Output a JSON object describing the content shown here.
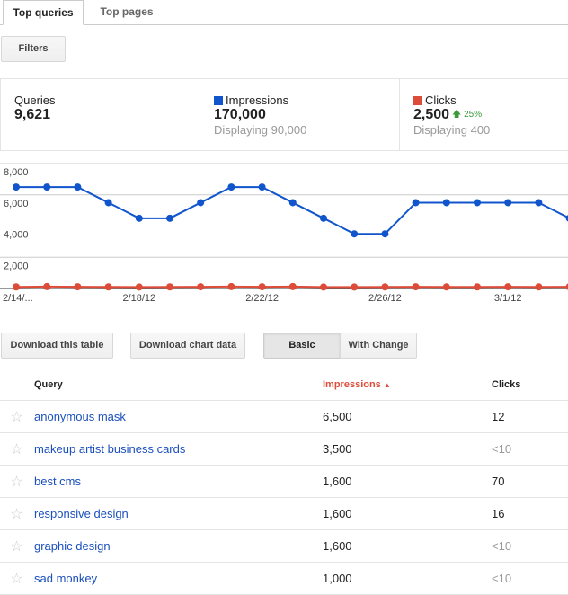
{
  "tabs": [
    {
      "label": "Top queries",
      "active": true
    },
    {
      "label": "Top pages",
      "active": false
    }
  ],
  "filters_label": "Filters",
  "summary": {
    "queries": {
      "label": "Queries",
      "value": "9,621"
    },
    "impressions": {
      "label": "Impressions",
      "value": "170,000",
      "sub": "Displaying 90,000",
      "color": "#1155cc"
    },
    "clicks": {
      "label": "Clicks",
      "value": "2,500",
      "change": "25%",
      "change_icon": "arrow-up-icon",
      "sub": "Displaying 400",
      "color": "#dd4b39"
    }
  },
  "chart_data": {
    "type": "line",
    "title": "",
    "xlabel": "",
    "ylabel": "",
    "ylim": [
      0,
      8000
    ],
    "yticks": [
      "2,000",
      "4,000",
      "6,000",
      "8,000"
    ],
    "ytick_values": [
      2000,
      4000,
      6000,
      8000
    ],
    "x": [
      "2/14/12",
      "2/15/12",
      "2/16/12",
      "2/17/12",
      "2/18/12",
      "2/19/12",
      "2/20/12",
      "2/21/12",
      "2/22/12",
      "2/23/12",
      "2/24/12",
      "2/25/12",
      "2/26/12",
      "2/27/12",
      "2/28/12",
      "2/29/12",
      "3/1/12",
      "3/2/12",
      "3/3/12"
    ],
    "xtick_labels": [
      {
        "index": 0,
        "label": "2/14/..."
      },
      {
        "index": 4,
        "label": "2/18/12"
      },
      {
        "index": 8,
        "label": "2/22/12"
      },
      {
        "index": 12,
        "label": "2/26/12"
      },
      {
        "index": 16,
        "label": "3/1/12"
      }
    ],
    "grid": true,
    "series": [
      {
        "name": "Impressions",
        "color": "#1155cc",
        "values": [
          6500,
          6500,
          6500,
          5500,
          4500,
          4500,
          5500,
          6500,
          6500,
          5500,
          4500,
          3500,
          3500,
          5500,
          5500,
          5500,
          5500,
          5500,
          4500
        ]
      },
      {
        "name": "Clicks",
        "color": "#dd4b39",
        "values": [
          100,
          120,
          110,
          100,
          90,
          100,
          110,
          120,
          110,
          120,
          90,
          90,
          100,
          110,
          100,
          100,
          110,
          100,
          110
        ]
      }
    ]
  },
  "buttons": {
    "download_table": "Download this table",
    "download_chart": "Download chart data",
    "basic": "Basic",
    "with_change": "With Change"
  },
  "table": {
    "headers": {
      "query": "Query",
      "impressions": "Impressions",
      "impressions_sort": "▲",
      "clicks": "Clicks"
    },
    "rows": [
      {
        "query": "anonymous mask",
        "impressions": "6,500",
        "clicks": "12",
        "clicks_muted": false
      },
      {
        "query": "makeup artist business cards",
        "impressions": "3,500",
        "clicks": "<10",
        "clicks_muted": true
      },
      {
        "query": "best cms",
        "impressions": "1,600",
        "clicks": "70",
        "clicks_muted": false
      },
      {
        "query": "responsive design",
        "impressions": "1,600",
        "clicks": "16",
        "clicks_muted": false
      },
      {
        "query": "graphic design",
        "impressions": "1,600",
        "clicks": "<10",
        "clicks_muted": true
      },
      {
        "query": "sad monkey",
        "impressions": "1,000",
        "clicks": "<10",
        "clicks_muted": true
      }
    ],
    "star_icon": "☆"
  }
}
